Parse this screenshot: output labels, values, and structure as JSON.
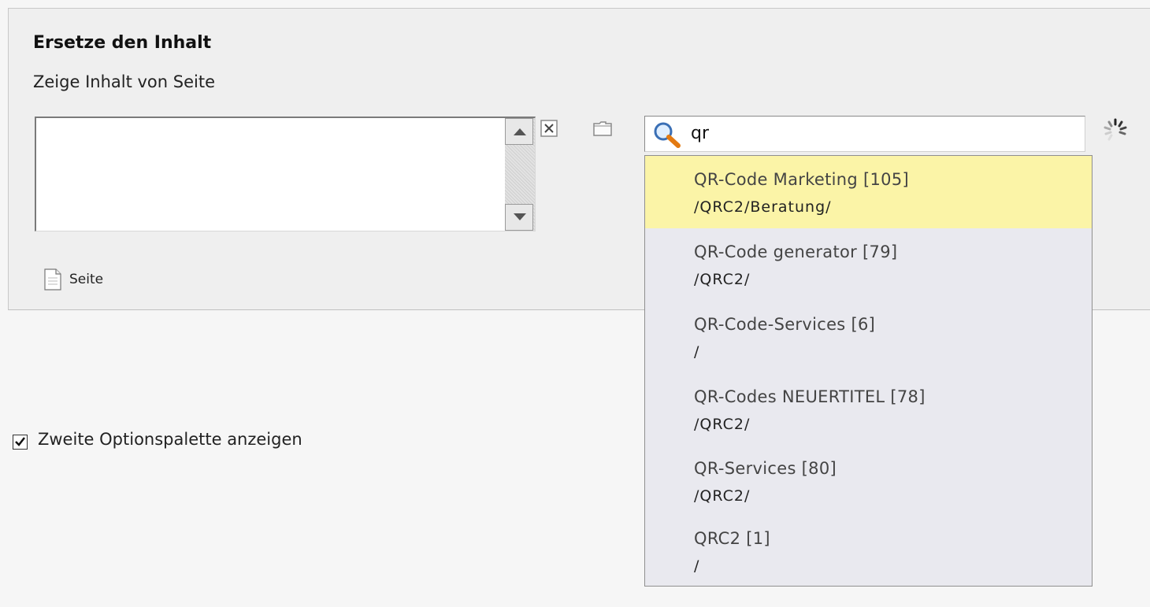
{
  "section": {
    "title": "Ersetze den Inhalt",
    "label": "Zeige Inhalt von Seite"
  },
  "record_type": "Seite",
  "search": {
    "query": "qr"
  },
  "results": [
    {
      "title": "QR-Code Marketing [105]",
      "path": "/QRC2/Beratung/"
    },
    {
      "title": "QR-Code generator [79]",
      "path": "/QRC2/"
    },
    {
      "title": "QR-Code-Services [6]",
      "path": "/"
    },
    {
      "title": "QR-Codes NEUERTITEL [78]",
      "path": "/QRC2/"
    },
    {
      "title": "QR-Services [80]",
      "path": "/QRC2/"
    },
    {
      "title": "QRC2 [1]",
      "path": "/"
    }
  ],
  "option": {
    "label": "Zweite Optionspalette anzeigen",
    "checked": true
  },
  "icons": {
    "clear": "close-icon",
    "browse": "folder-icon",
    "search": "magnifier-icon",
    "loading": "spinner-icon",
    "page": "page-icon"
  },
  "colors": {
    "highlight": "#fbf4a7",
    "dropdown_bg": "#e9e9ef",
    "panel_bg": "#efefef"
  }
}
